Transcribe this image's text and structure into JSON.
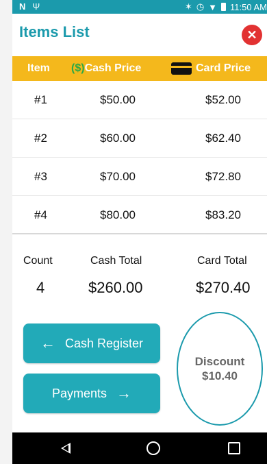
{
  "status_bar": {
    "time": "11:50 AM",
    "left_icons": [
      "n-icon",
      "usb-icon"
    ],
    "right_icons": [
      "bluetooth-icon",
      "alarm-icon",
      "wifi-icon",
      "battery-icon"
    ]
  },
  "header": {
    "title": "Items List"
  },
  "table": {
    "headers": {
      "item": "Item",
      "cash_symbol": "($)",
      "cash": "Cash Price",
      "card": "Card Price"
    },
    "rows": [
      {
        "item": "#1",
        "cash": "$50.00",
        "card": "$52.00"
      },
      {
        "item": "#2",
        "cash": "$60.00",
        "card": "$62.40"
      },
      {
        "item": "#3",
        "cash": "$70.00",
        "card": "$72.80"
      },
      {
        "item": "#4",
        "cash": "$80.00",
        "card": "$83.20"
      }
    ]
  },
  "totals": {
    "count_label": "Count",
    "count": "4",
    "cash_label": "Cash Total",
    "cash": "$260.00",
    "card_label": "Card Total",
    "card": "$270.40"
  },
  "buttons": {
    "cash_register": "Cash Register",
    "payments": "Payments"
  },
  "discount": {
    "label": "Discount",
    "amount": "$10.40"
  },
  "colors": {
    "teal": "#1b9aac",
    "button": "#22aab8",
    "header_bar": "#f4b81c",
    "close": "#e23232",
    "cash_symbol": "#2ca944"
  }
}
